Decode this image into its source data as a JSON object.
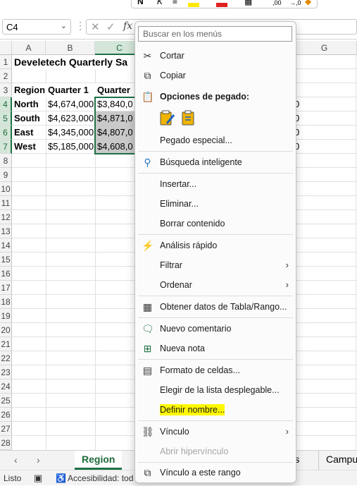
{
  "formula_bar": {
    "name_box": "C4",
    "fx_label": "fx"
  },
  "columns": [
    "A",
    "B",
    "C",
    "D",
    "E",
    "F",
    "G"
  ],
  "rows": [
    "1",
    "2",
    "3",
    "4",
    "5",
    "6",
    "7",
    "8",
    "9",
    "10",
    "11",
    "12",
    "13",
    "14",
    "15",
    "16",
    "17",
    "18",
    "19",
    "20",
    "21",
    "22",
    "23",
    "24",
    "25",
    "26",
    "27",
    "28"
  ],
  "sheet": {
    "title": "Develetech Quarterly Sa",
    "headers": [
      "Region",
      "Quarter 1",
      "Quarter"
    ],
    "data": [
      [
        "North",
        "$4,674,000",
        "$3,840,0"
      ],
      [
        "South",
        "$4,623,000",
        "$4,871,0"
      ],
      [
        "East",
        "$4,345,000",
        "$4,807,0"
      ],
      [
        "West",
        "$5,185,000",
        "$4,608,0"
      ]
    ],
    "right_fragments": [
      "0",
      "0",
      "0",
      "0"
    ]
  },
  "tabs": {
    "active": "Region",
    "partial1": "ils",
    "partial2": "Campu"
  },
  "status": {
    "ready": "Listo",
    "accessibility": "Accesibilidad: tod"
  },
  "context_menu": {
    "search_placeholder": "Buscar en los menús",
    "cut": "Cortar",
    "copy": "Copiar",
    "paste_options": "Opciones de pegado:",
    "paste_special": "Pegado especial...",
    "smart_lookup": "Búsqueda inteligente",
    "insert": "Insertar...",
    "delete": "Eliminar...",
    "clear_contents": "Borrar contenido",
    "quick_analysis": "Análisis rápido",
    "filter": "Filtrar",
    "sort": "Ordenar",
    "get_data": "Obtener datos de Tabla/Rango...",
    "new_comment": "Nuevo comentario",
    "new_note": "Nueva nota",
    "format_cells": "Formato de celdas...",
    "pick_from_list": "Elegir de la lista desplegable...",
    "define_name": "Definir nombre...",
    "link": "Vínculo",
    "open_hyperlink": "Abrir hipervínculo",
    "link_to_range": "Vínculo a este rango"
  },
  "colors": {
    "accent_green": "#1e7145",
    "highlight": "#fff800"
  }
}
